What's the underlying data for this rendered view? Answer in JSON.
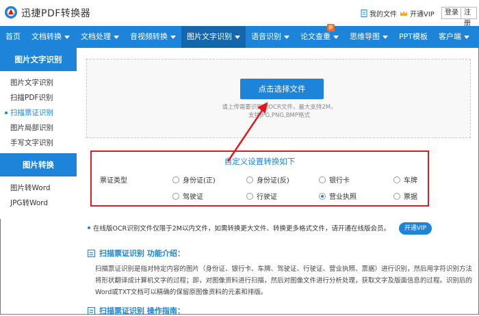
{
  "header": {
    "app_name": "迅捷PDF转换器",
    "my_files": "我的文件",
    "open_vip": "开通VIP",
    "login": "登录",
    "register": "注册"
  },
  "nav": {
    "items": [
      {
        "label": "首页",
        "caret": false
      },
      {
        "label": "文档转换",
        "caret": true
      },
      {
        "label": "文档处理",
        "caret": true
      },
      {
        "label": "音视频转换",
        "caret": true
      },
      {
        "label": "图片文字识别",
        "caret": true,
        "active": true
      },
      {
        "label": "语音识别",
        "caret": true
      },
      {
        "label": "论文查重",
        "caret": true,
        "badge": "新"
      },
      {
        "label": "思维导图",
        "caret": true
      },
      {
        "label": "PPT模板",
        "caret": false
      },
      {
        "label": "客户端",
        "caret": true
      }
    ]
  },
  "sidebar": {
    "ocr_title": "图片文字识别",
    "ocr_items": [
      "图片文字识别",
      "扫描PDF识别",
      "扫描票证识别",
      "图片局部识别",
      "手写文字识别"
    ],
    "active_item": "扫描票证识别",
    "convert_title": "图片转换",
    "convert_items": [
      "图片转Word",
      "JPG转Word"
    ]
  },
  "upload": {
    "button": "点击选择文件",
    "hint_line1": "请上传需要识别的OCR文件，最大支持2M，",
    "hint_line2": "支持JPG,PNG,BMP格式"
  },
  "settings": {
    "title": "自定义设置转换如下",
    "label": "票证类型",
    "options": [
      "身份证(正)",
      "身份证(反)",
      "银行卡",
      "车牌",
      "驾驶证",
      "行驶证",
      "营业执照",
      "票据"
    ],
    "selected": "营业执照"
  },
  "notice": {
    "text": "在线版OCR识别文件仅限于2M以内文件，如需转换更大文件、转换更多格式文件，请开通在线版会员。",
    "vip_button": "开通VIP"
  },
  "intro": {
    "title": "扫描票证识别 功能介绍：",
    "body": "扫描票证识别是指对特定内容的图片（身份证、银行卡、车牌、驾驶证、行驶证、营业执照、票据）进行识别，然后用字符识别方法将形状翻译成计算机文字的过程；即，对图像资料进行扫描，然后对图像文件进行分析处理，获取文字及版面信息的过程。识别后的Word或TXT文档可以精确的保留原图像资料的元素和排版。",
    "guide_title": "扫描票证识别 操作指南："
  },
  "colors": {
    "brand_blue": "#1d84d9",
    "nav_active": "#1467ad",
    "highlight_red": "#e0181f",
    "badge_orange": "#f06a21"
  }
}
